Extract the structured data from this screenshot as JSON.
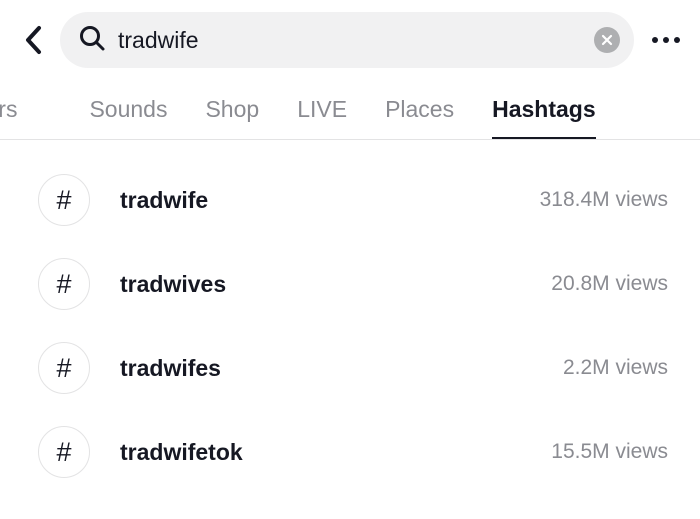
{
  "search": {
    "value": "tradwife"
  },
  "tabs": [
    {
      "label": "sers",
      "active": false,
      "partial": true
    },
    {
      "label": "Sounds",
      "active": false
    },
    {
      "label": "Shop",
      "active": false
    },
    {
      "label": "LIVE",
      "active": false
    },
    {
      "label": "Places",
      "active": false
    },
    {
      "label": "Hashtags",
      "active": true
    }
  ],
  "results": [
    {
      "name": "tradwife",
      "views": "318.4M views"
    },
    {
      "name": "tradwives",
      "views": "20.8M views"
    },
    {
      "name": "tradwifes",
      "views": "2.2M views"
    },
    {
      "name": "tradwifetok",
      "views": "15.5M views"
    }
  ]
}
